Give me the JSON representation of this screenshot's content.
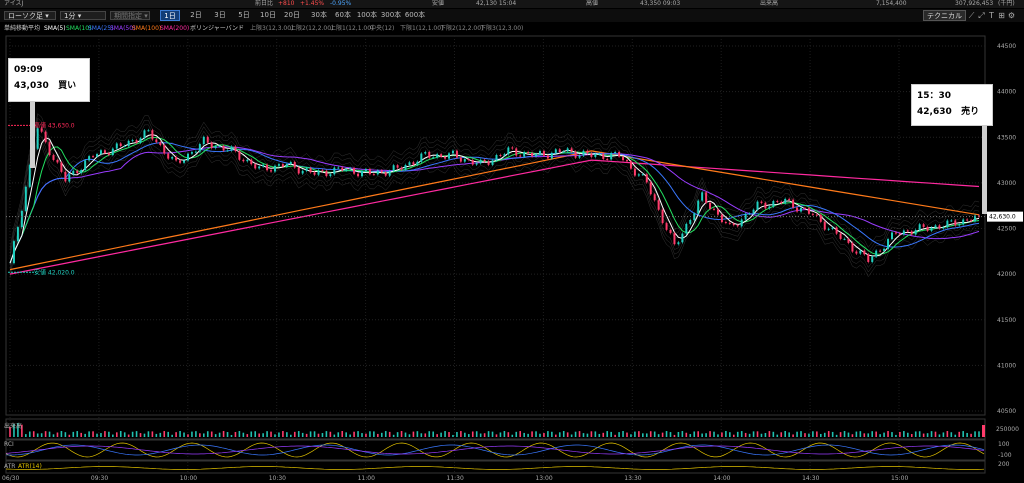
{
  "topbar": {
    "symbol": "アイスJ",
    "prev_close_label": "前日比",
    "change": "+810",
    "change_pct": "+1.45%",
    "change_pct2": "-0.95%",
    "low_label": "安値",
    "low_value": "42,130 15:04",
    "high_label": "高値",
    "high_value": "43,350 09:03",
    "volume_label": "出来高",
    "volume_value": "7,154,400",
    "turnover_value": "307,926,453",
    "turnover_unit": "(千円)"
  },
  "toolbar": {
    "chart_type": "ローソク足",
    "interval": "1分",
    "period": "期間指定",
    "ranges": [
      "1日",
      "2日",
      "3日",
      "5日",
      "10日",
      "20日",
      "30本",
      "60本",
      "100本",
      "300本",
      "600本"
    ],
    "active_range": "1日",
    "technical_button": "テクニカル"
  },
  "legend": {
    "items": [
      {
        "label": "単純移動平均",
        "color": "#cccccc"
      },
      {
        "label": "SMA(5)",
        "color": "#ffffff"
      },
      {
        "label": "SMA(10)",
        "color": "#22e060"
      },
      {
        "label": "SMA(25)",
        "color": "#3a78ff"
      },
      {
        "label": "SMA(50)",
        "color": "#9a3cff"
      },
      {
        "label": "SMA(100)",
        "color": "#ff7a1a"
      },
      {
        "label": "SMA(200)",
        "color": "#ff2aa0"
      },
      {
        "label": "ボリンジャーバンド",
        "color": "#cccccc"
      },
      {
        "label": "上限3(12,3.00)",
        "color": "#888888"
      },
      {
        "label": "上限2(12,2.00)",
        "color": "#888888"
      },
      {
        "label": "上限1(12,1.00)",
        "color": "#888888"
      },
      {
        "label": "中央(12)",
        "color": "#888888"
      },
      {
        "label": "下限1(12,1.00)",
        "color": "#888888"
      },
      {
        "label": "下限2(12,2.00)",
        "color": "#888888"
      },
      {
        "label": "下限3(12,3.00)",
        "color": "#888888"
      }
    ]
  },
  "annotations": {
    "buy": {
      "time": "09:09",
      "price": "43,030",
      "action": "買い"
    },
    "sell": {
      "time": "15：30",
      "price": "42,630",
      "action": "売り"
    },
    "high_marker": "高値 43,630.0",
    "low_marker": "安値 42,020.0",
    "last_price_tag": "42,630.0"
  },
  "subpanels": {
    "volume_label": "出来高",
    "volume_axis": "250000",
    "rci_label": "RCI",
    "rci_axis": [
      "100",
      "-100"
    ],
    "atr_label": "ATR",
    "atr_param": "ATR(14)",
    "atr_axis": "200"
  },
  "chart_data": {
    "type": "candlestick",
    "interval": "1分",
    "ylim": [
      40500,
      44500
    ],
    "yticks": [
      40500,
      41000,
      41500,
      42000,
      42500,
      43000,
      43500,
      44000,
      44500
    ],
    "xticks": [
      "06/30",
      "09:30",
      "10:00",
      "10:30",
      "11:00",
      "11:30",
      "13:00",
      "13:30",
      "14:00",
      "14:30",
      "15:00"
    ],
    "last_price": 42630,
    "high": 43630,
    "low": 42020,
    "approx_close_path": {
      "times": [
        "09:00",
        "09:05",
        "09:09",
        "09:20",
        "09:40",
        "09:50",
        "10:00",
        "10:10",
        "10:20",
        "10:30",
        "10:40",
        "10:50",
        "11:00",
        "11:10",
        "11:20",
        "11:30",
        "12:30",
        "12:40",
        "12:50",
        "13:00",
        "13:10",
        "13:20",
        "13:30",
        "13:40",
        "13:50",
        "14:00",
        "14:05",
        "14:10",
        "14:20",
        "14:30",
        "14:40",
        "14:50",
        "15:00",
        "15:10",
        "15:20",
        "15:30"
      ],
      "values": [
        42100,
        43600,
        43030,
        43300,
        43400,
        43550,
        43200,
        43450,
        43350,
        43150,
        43200,
        43100,
        43150,
        43100,
        43150,
        43300,
        43300,
        43200,
        43350,
        43300,
        43350,
        43300,
        43300,
        43000,
        42300,
        42850,
        42500,
        42750,
        42800,
        42650,
        42400,
        42150,
        42450,
        42500,
        42550,
        42630
      ]
    },
    "sma200_path": {
      "start": 42000,
      "mid": 43250,
      "end": 42960
    },
    "sma100_path": {
      "start": 42050,
      "mid": 43350,
      "end": 42650
    }
  }
}
